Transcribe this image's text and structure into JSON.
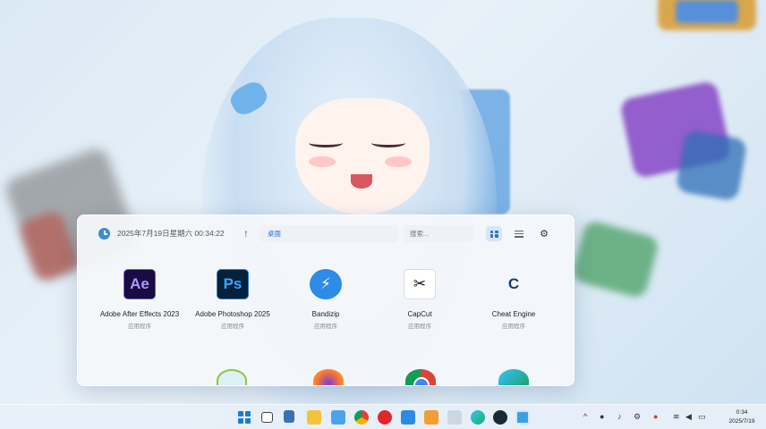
{
  "launcher": {
    "datetime": "2025年7月19日星期六 00:34:22",
    "path": "桌面",
    "search_placeholder": "搜索...",
    "up_glyph": "↑",
    "settings_glyph": "⚙",
    "view_mode": "grid",
    "apps": [
      {
        "name": "Adobe After Effects 2023",
        "type": "应用程序",
        "icon": "after-effects-icon",
        "glyph": "Ae"
      },
      {
        "name": "Adobe Photoshop 2025",
        "type": "应用程序",
        "icon": "photoshop-icon",
        "glyph": "Ps"
      },
      {
        "name": "Bandizip",
        "type": "应用程序",
        "icon": "bandizip-icon",
        "glyph": "⚡"
      },
      {
        "name": "CapCut",
        "type": "应用程序",
        "icon": "capcut-icon",
        "glyph": "✂"
      },
      {
        "name": "Cheat Engine",
        "type": "应用程序",
        "icon": "cheat-engine-icon",
        "glyph": "C"
      }
    ]
  },
  "taskbar": {
    "clock_time": "0:34",
    "clock_date": "2025/7/19",
    "pinned": [
      "start-icon",
      "task-view-icon",
      "folder-blue-icon",
      "file-explorer-icon",
      "store-icon",
      "chrome-icon",
      "netease-music-icon",
      "vscode-icon",
      "sandbox-icon",
      "pen-icon",
      "edge-icon",
      "steam-icon",
      "gallery-icon"
    ]
  },
  "colors": {
    "accent": "#2a72c8",
    "panel_bg": "#f4f7fa"
  }
}
